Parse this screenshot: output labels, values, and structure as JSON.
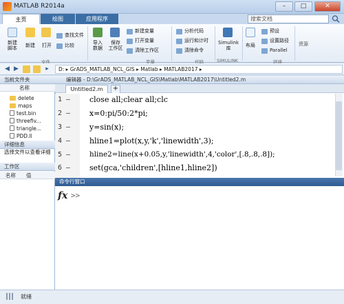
{
  "window": {
    "title": "MATLAB R2014a"
  },
  "tabs": [
    {
      "label": "主页"
    },
    {
      "label": "绘图"
    },
    {
      "label": "应用程序"
    }
  ],
  "search": {
    "placeholder": "搜索文档"
  },
  "ribbon": {
    "file": {
      "new_script": "新建\n脚本",
      "new": "新建",
      "open": "打开",
      "find_files": "查找文件",
      "compare": "比较",
      "group": "文件"
    },
    "variable": {
      "import": "导入\n数据",
      "save_ws": "保存\n工作区",
      "new_var": "新建变量",
      "open_var": "打开变量",
      "clear_ws": "清除工作区",
      "group": "变量"
    },
    "code": {
      "analyze": "分析代码",
      "run_time": "运行和计时",
      "clear_cmd": "清除命令",
      "group": "代码"
    },
    "simulink": {
      "label": "Simulink\n库",
      "group": "SIMULINK"
    },
    "env": {
      "layout": "布局",
      "preferences": "预设",
      "set_path": "设置路径",
      "parallel": "Parallel",
      "group": "环境"
    },
    "resources": {
      "label": "资源"
    }
  },
  "address": {
    "path": "D: ▸ GrADS_MATLAB_NCL_GIS ▸ Matlab ▸ MATLAB2017 ▸"
  },
  "current_folder": {
    "title": "当前文件夹",
    "column": "名称",
    "items": [
      {
        "name": "delete",
        "type": "folder"
      },
      {
        "name": "maps",
        "type": "folder"
      },
      {
        "name": "test.bin",
        "type": "file"
      },
      {
        "name": "threefiv...",
        "type": "file"
      },
      {
        "name": "triangle...",
        "type": "file"
      },
      {
        "name": "PDD.ll",
        "type": "file"
      }
    ]
  },
  "details": {
    "title": "详细信息",
    "text": "选择文件以查看详细"
  },
  "workspace": {
    "title": "工作区",
    "col_name": "名称",
    "col_value": "值"
  },
  "editor": {
    "title": "编辑器 - D:\\GrADS_MATLAB_NCL_GIS\\Matlab\\MATLAB2017\\Untitled2.m",
    "tab": "Untitled2.m",
    "lines": [
      {
        "n": "1",
        "text": "close all;clear all;clc"
      },
      {
        "n": "2",
        "text": "x=0:pi/50:2*pi;"
      },
      {
        "n": "3",
        "text": "y=sin(x);"
      },
      {
        "n": "4",
        "text": "hline1=plot(x,y,'k','linewidth',3);"
      },
      {
        "n": "5",
        "text": "hline2=line(x+0.05,y,'linewidth',4,'color',[.8,.8,.8]);"
      },
      {
        "n": "6",
        "text": "set(gca,'children',[hline1,hline2])"
      }
    ]
  },
  "command_window": {
    "title": "命令行窗口",
    "prompt": ">>",
    "fx": "fx"
  },
  "status": {
    "text": "就绪"
  }
}
